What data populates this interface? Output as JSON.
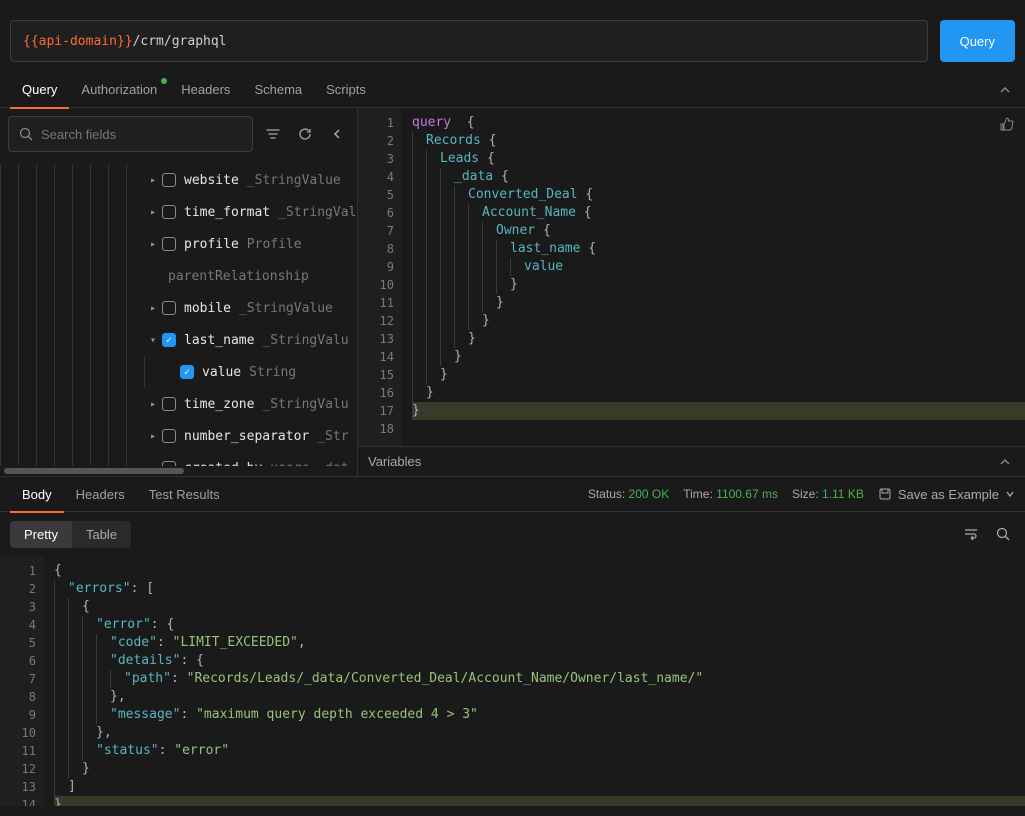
{
  "url": {
    "template": "{{api-domain}}",
    "path": "/crm/graphql"
  },
  "query_button": "Query",
  "tabs": {
    "items": [
      "Query",
      "Authorization",
      "Headers",
      "Schema",
      "Scripts"
    ],
    "active": 0,
    "auth_indicator": true
  },
  "search": {
    "placeholder": "Search fields"
  },
  "fields": [
    {
      "depth": 8,
      "twist": "right",
      "checked": false,
      "name": "website",
      "type": "_StringValue"
    },
    {
      "depth": 8,
      "twist": "right",
      "checked": false,
      "name": "time_format",
      "type": "_StringValue"
    },
    {
      "depth": 8,
      "twist": "right",
      "checked": false,
      "name": "profile",
      "type": "Profile",
      "type2": "parentRelationship"
    },
    {
      "depth": 8,
      "twist": "right",
      "checked": false,
      "name": "mobile",
      "type": "_StringValue"
    },
    {
      "depth": 8,
      "twist": "down",
      "checked": true,
      "name": "last_name",
      "type": "_StringValu"
    },
    {
      "depth": 9,
      "twist": "",
      "checked": true,
      "name": "value",
      "type": "String"
    },
    {
      "depth": 8,
      "twist": "right",
      "checked": false,
      "name": "time_zone",
      "type": "_StringValu"
    },
    {
      "depth": 8,
      "twist": "right",
      "checked": false,
      "name": "number_separator",
      "type": "_Str"
    },
    {
      "depth": 8,
      "twist": "right",
      "checked": false,
      "name": "created_by",
      "type": "users__dat"
    }
  ],
  "query_editor": {
    "line_count": 18,
    "tokens": [
      [
        {
          "t": "query",
          "c": "kw"
        },
        {
          "t": "  ",
          "c": ""
        },
        {
          "t": "{",
          "c": "pun"
        }
      ],
      [
        {
          "i": 1
        },
        {
          "t": "Records",
          "c": "fld"
        },
        {
          "t": " {",
          "c": "pun"
        }
      ],
      [
        {
          "i": 2
        },
        {
          "t": "Leads",
          "c": "fld"
        },
        {
          "t": " {",
          "c": "pun"
        }
      ],
      [
        {
          "i": 3
        },
        {
          "t": "_data",
          "c": "fld"
        },
        {
          "t": " {",
          "c": "pun"
        }
      ],
      [
        {
          "i": 4
        },
        {
          "t": "Converted_Deal",
          "c": "fld"
        },
        {
          "t": " {",
          "c": "pun"
        }
      ],
      [
        {
          "i": 5
        },
        {
          "t": "Account_Name",
          "c": "fld"
        },
        {
          "t": " {",
          "c": "pun"
        }
      ],
      [
        {
          "i": 6
        },
        {
          "t": "Owner",
          "c": "fld"
        },
        {
          "t": " {",
          "c": "pun"
        }
      ],
      [
        {
          "i": 7
        },
        {
          "t": "last_name",
          "c": "fld"
        },
        {
          "t": " {",
          "c": "pun"
        }
      ],
      [
        {
          "i": 8
        },
        {
          "t": "value",
          "c": "fld"
        }
      ],
      [
        {
          "i": 7
        },
        {
          "t": "}",
          "c": "pun"
        }
      ],
      [
        {
          "i": 6
        },
        {
          "t": "}",
          "c": "pun"
        }
      ],
      [
        {
          "i": 5
        },
        {
          "t": "}",
          "c": "pun"
        }
      ],
      [
        {
          "i": 4
        },
        {
          "t": "}",
          "c": "pun"
        }
      ],
      [
        {
          "i": 3
        },
        {
          "t": "}",
          "c": "pun"
        }
      ],
      [
        {
          "i": 2
        },
        {
          "t": "}",
          "c": "pun"
        }
      ],
      [
        {
          "i": 1
        },
        {
          "t": "}",
          "c": "pun"
        }
      ],
      [
        {
          "t": "}",
          "c": "pun",
          "hl": true
        }
      ],
      []
    ]
  },
  "variables_label": "Variables",
  "response_tabs": {
    "items": [
      "Body",
      "Headers",
      "Test Results"
    ],
    "active": 0
  },
  "status": {
    "status_label": "Status:",
    "status_value": "200 OK",
    "time_label": "Time:",
    "time_value": "1100.67 ms",
    "size_label": "Size:",
    "size_value": "1.11 KB",
    "save_label": "Save as Example"
  },
  "view_modes": {
    "items": [
      "Pretty",
      "Table"
    ],
    "active": 0
  },
  "response_editor": {
    "line_count": 14,
    "tokens": [
      [
        {
          "t": "{",
          "c": "jpun"
        }
      ],
      [
        {
          "i": 1
        },
        {
          "t": "\"errors\"",
          "c": "jkey"
        },
        {
          "t": ": [",
          "c": "jpun"
        }
      ],
      [
        {
          "i": 2
        },
        {
          "t": "{",
          "c": "jpun"
        }
      ],
      [
        {
          "i": 3
        },
        {
          "t": "\"error\"",
          "c": "jkey"
        },
        {
          "t": ": {",
          "c": "jpun"
        }
      ],
      [
        {
          "i": 4
        },
        {
          "t": "\"code\"",
          "c": "jkey"
        },
        {
          "t": ": ",
          "c": "jpun"
        },
        {
          "t": "\"LIMIT_EXCEEDED\"",
          "c": "jstr"
        },
        {
          "t": ",",
          "c": "jpun"
        }
      ],
      [
        {
          "i": 4
        },
        {
          "t": "\"details\"",
          "c": "jkey"
        },
        {
          "t": ": {",
          "c": "jpun"
        }
      ],
      [
        {
          "i": 5
        },
        {
          "t": "\"path\"",
          "c": "jkey"
        },
        {
          "t": ": ",
          "c": "jpun"
        },
        {
          "t": "\"Records/Leads/_data/Converted_Deal/Account_Name/Owner/last_name/\"",
          "c": "jstr"
        }
      ],
      [
        {
          "i": 4
        },
        {
          "t": "},",
          "c": "jpun"
        }
      ],
      [
        {
          "i": 4
        },
        {
          "t": "\"message\"",
          "c": "jkey"
        },
        {
          "t": ": ",
          "c": "jpun"
        },
        {
          "t": "\"maximum query depth exceeded 4 > 3\"",
          "c": "jstr"
        }
      ],
      [
        {
          "i": 3
        },
        {
          "t": "},",
          "c": "jpun"
        }
      ],
      [
        {
          "i": 3
        },
        {
          "t": "\"status\"",
          "c": "jkey"
        },
        {
          "t": ": ",
          "c": "jpun"
        },
        {
          "t": "\"error\"",
          "c": "jstr"
        }
      ],
      [
        {
          "i": 2
        },
        {
          "t": "}",
          "c": "jpun"
        }
      ],
      [
        {
          "i": 1
        },
        {
          "t": "]",
          "c": "jpun"
        }
      ],
      [
        {
          "t": "}",
          "c": "jpun",
          "hl": true
        }
      ]
    ]
  }
}
